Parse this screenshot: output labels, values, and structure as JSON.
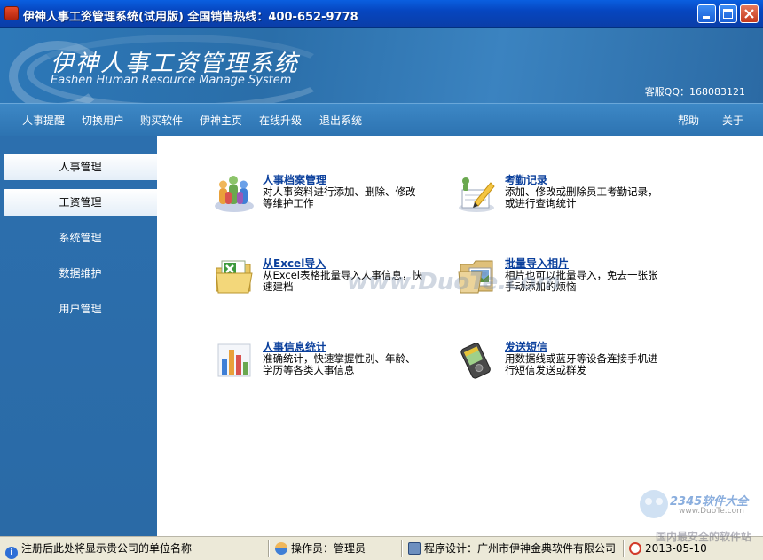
{
  "window": {
    "title": "伊神人事工资管理系统(试用版)  全国销售热线：400-652-9778"
  },
  "banner": {
    "title_cn": "伊神人事工资管理系统",
    "title_en": "Eashen Human Resource Manage System",
    "qq": "客服QQ：168083121"
  },
  "menu": {
    "left": [
      "人事提醒",
      "切换用户",
      "购买软件",
      "伊神主页",
      "在线升级",
      "退出系统"
    ],
    "right": [
      "帮助",
      "关于"
    ]
  },
  "sidebar": {
    "items": [
      {
        "label": "人事管理",
        "active": true
      },
      {
        "label": "工资管理",
        "active": true
      },
      {
        "label": "系统管理",
        "active": false
      },
      {
        "label": "数据维护",
        "active": false
      },
      {
        "label": "用户管理",
        "active": false
      }
    ]
  },
  "cards": [
    {
      "title": "人事档案管理",
      "desc": "对人事资料进行添加、删除、修改等维护工作",
      "icon": "people-icon"
    },
    {
      "title": "考勤记录",
      "desc": "添加、修改或删除员工考勤记录，或进行查询统计",
      "icon": "attendance-pencil-icon"
    },
    {
      "title": "从Excel导入",
      "desc": "从Excel表格批量导入人事信息，快速建档",
      "icon": "excel-folder-icon"
    },
    {
      "title": "批量导入相片",
      "desc": "相片也可以批量导入，免去一张张手动添加的烦恼",
      "icon": "photo-folder-icon"
    },
    {
      "title": "人事信息统计",
      "desc": "准确统计，快速掌握性别、年龄、学历等各类人事信息",
      "icon": "bar-chart-icon"
    },
    {
      "title": "发送短信",
      "desc": "用数据线或蓝牙等设备连接手机进行短信发送或群发",
      "icon": "pda-icon"
    }
  ],
  "watermark": "www.DuoTe.com",
  "statusbar": {
    "info": "注册后此处将显示贵公司的单位名称",
    "operator": "操作员：管理员",
    "designer": "程序设计：广州市伊神金典软件有限公司",
    "date": "2013-05-10"
  },
  "corner_badge": {
    "brand": "2345软件大全",
    "url": "www.DuoTe.com",
    "slogan": "国内最安全的软件站"
  },
  "colors": {
    "titlebar": "#0646c0",
    "banner": "#2d78b8",
    "sidebar": "#2c6fae",
    "link": "#0a3f9c",
    "statusbar": "#ece9d8"
  }
}
